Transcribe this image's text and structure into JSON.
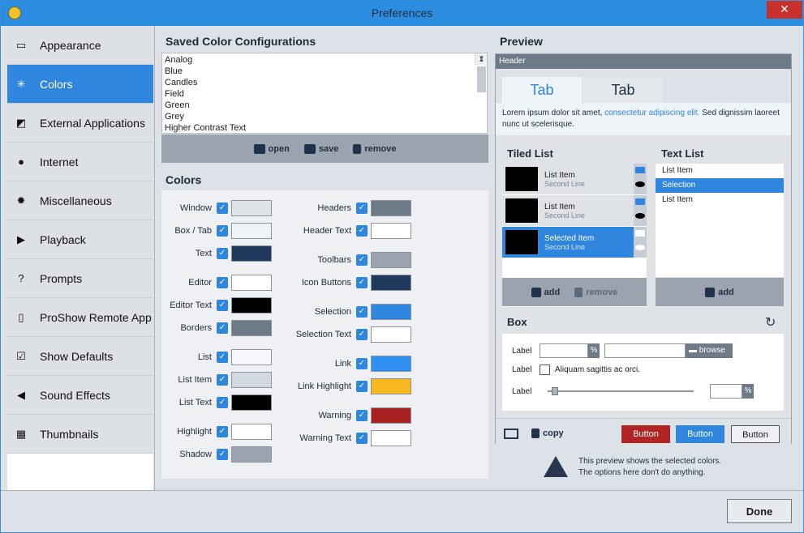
{
  "window": {
    "title": "Preferences",
    "close_glyph": "✕"
  },
  "sidebar": {
    "items": [
      {
        "label": "Appearance",
        "icon": "window-icon"
      },
      {
        "label": "Colors",
        "icon": "color-burst-icon"
      },
      {
        "label": "External Applications",
        "icon": "external-app-icon"
      },
      {
        "label": "Internet",
        "icon": "globe-icon"
      },
      {
        "label": "Miscellaneous",
        "icon": "gear-icon"
      },
      {
        "label": "Playback",
        "icon": "play-icon"
      },
      {
        "label": "Prompts",
        "icon": "question-icon"
      },
      {
        "label": "ProShow Remote App",
        "icon": "phone-icon"
      },
      {
        "label": "Show Defaults",
        "icon": "checkbox-icon"
      },
      {
        "label": "Sound Effects",
        "icon": "speaker-icon"
      },
      {
        "label": "Thumbnails",
        "icon": "thumbnail-icon"
      }
    ],
    "active": "Colors"
  },
  "saved": {
    "heading": "Saved Color Configurations",
    "items": [
      "Analog",
      "Blue",
      "Candles",
      "Field",
      "Green",
      "Grey",
      "Higher Contrast Text"
    ],
    "open": "open",
    "save": "save",
    "remove": "remove"
  },
  "colors": {
    "heading": "Colors",
    "left": [
      {
        "label": "Window",
        "color": "#dfe3e8"
      },
      {
        "label": "Box / Tab",
        "color": "#eef3f8"
      },
      {
        "label": "Text",
        "color": "#1f3a5c"
      },
      {
        "label": "Editor",
        "color": "#ffffff"
      },
      {
        "label": "Editor Text",
        "color": "#000000"
      },
      {
        "label": "Borders",
        "color": "#6e7a88"
      },
      {
        "label": "List",
        "color": "#f5f7fa"
      },
      {
        "label": "List Item",
        "color": "#d3d9e0"
      },
      {
        "label": "List Text",
        "color": "#000000"
      },
      {
        "label": "Highlight",
        "color": "#ffffff"
      },
      {
        "label": "Shadow",
        "color": "#9aa3ae"
      }
    ],
    "right": [
      {
        "label": "Headers",
        "color": "#6e7a88"
      },
      {
        "label": "Header Text",
        "color": "#ffffff"
      },
      {
        "label": "Toolbars",
        "color": "#9aa3ae"
      },
      {
        "label": "Icon Buttons",
        "color": "#1f3a5c"
      },
      {
        "label": "Selection",
        "color": "#2f86de"
      },
      {
        "label": "Selection Text",
        "color": "#ffffff"
      },
      {
        "label": "Link",
        "color": "#2f8ff0"
      },
      {
        "label": "Link Highlight",
        "color": "#f5b820"
      },
      {
        "label": "Warning",
        "color": "#a82020"
      },
      {
        "label": "Warning Text",
        "color": "#ffffff"
      }
    ]
  },
  "preview": {
    "heading": "Preview",
    "header": "Header",
    "tab_active": "Tab",
    "tab_other": "Tab",
    "lorem_pre": "Lorem ipsum dolor sit amet, ",
    "lorem_link": "consectetur adipiscing elit.",
    "lorem_post": " Sed dignissim laoreet nunc ut scelerisque.",
    "tiled_heading": "Tiled List",
    "tiles": [
      {
        "title": "List Item",
        "sub": "Second Line"
      },
      {
        "title": "List Item",
        "sub": "Second Line"
      },
      {
        "title": "Selected Item",
        "sub": "Second Line"
      }
    ],
    "add": "add",
    "remove": "remove",
    "text_heading": "Text List",
    "text_items": [
      "List Item",
      "Selection",
      "List Item"
    ],
    "text_add": "add",
    "box_heading": "Box",
    "label": "Label",
    "pct": "%",
    "browse": "browse",
    "check_text": "Aliquam sagittis ac orci.",
    "slider_value": 0.03,
    "copy": "copy",
    "btn_red": "Button",
    "btn_blue": "Button",
    "btn_plain": "Button",
    "warn1": "This preview shows the selected colors.",
    "warn2": "The options here don't do anything."
  },
  "done": "Done"
}
